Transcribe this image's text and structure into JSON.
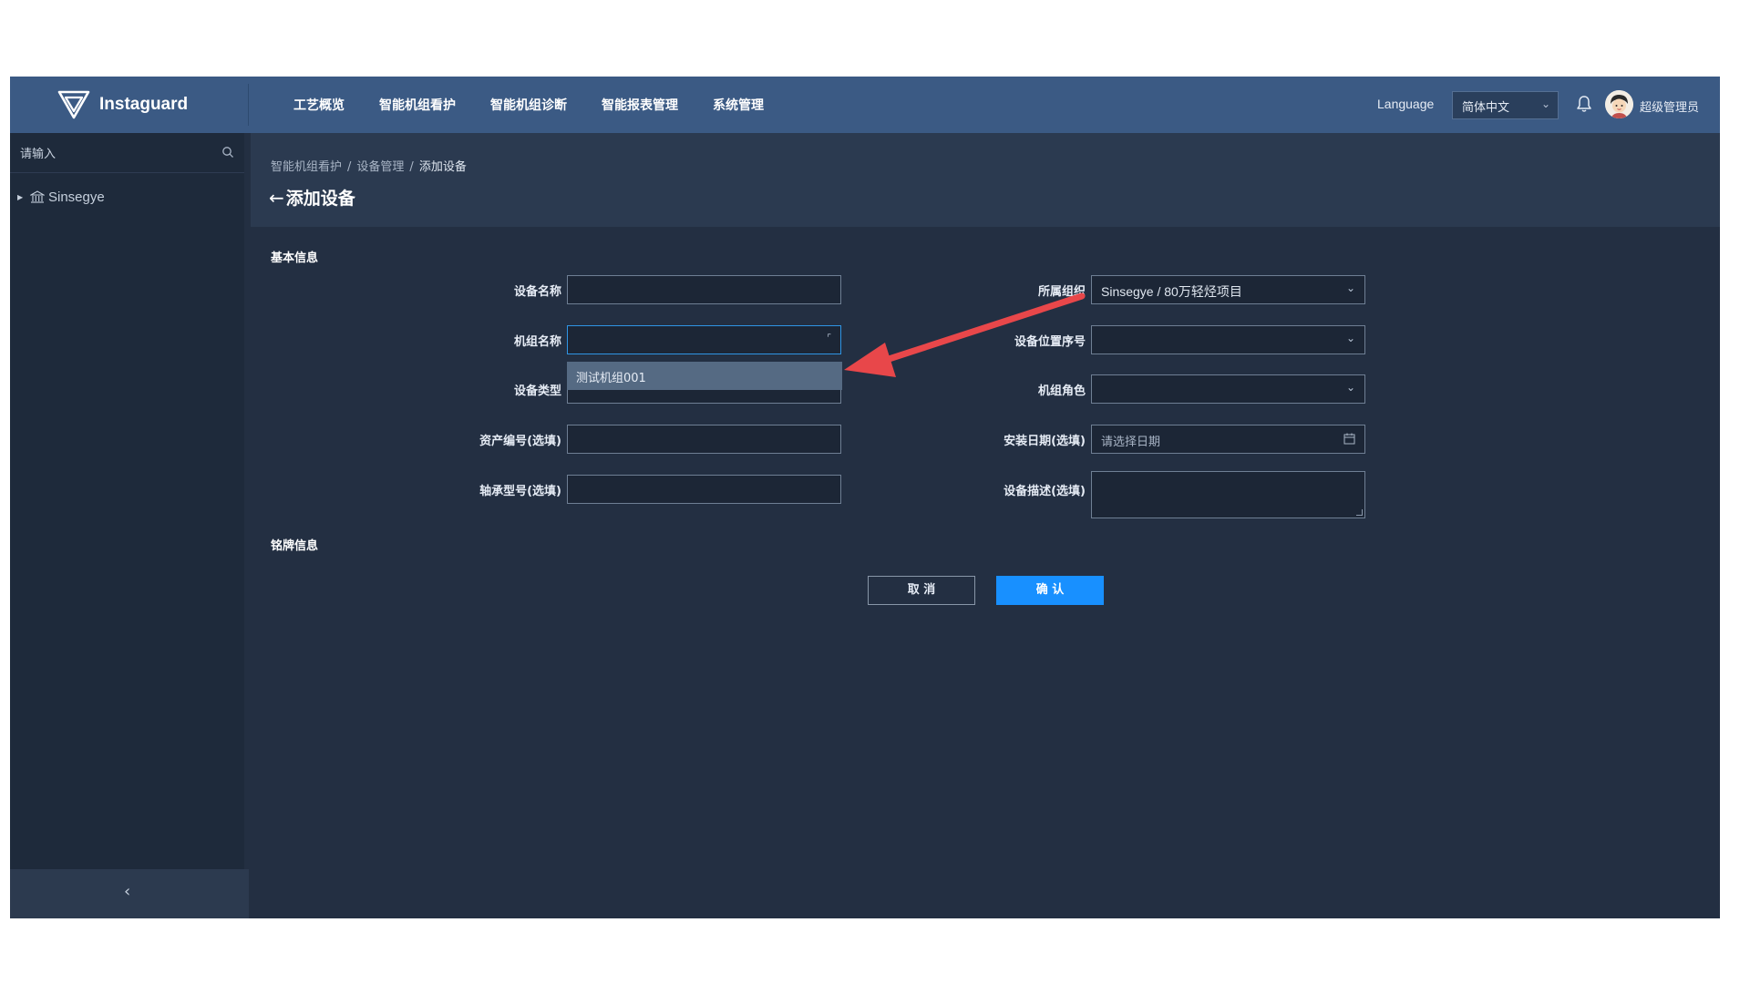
{
  "app": {
    "brand": "Instaguard",
    "nav": [
      "工艺概览",
      "智能机组看护",
      "智能机组诊断",
      "智能报表管理",
      "系统管理"
    ],
    "language_label": "Language",
    "language_value": "简体中文",
    "user_name": "超级管理员"
  },
  "sidebar": {
    "search_placeholder": "请输入",
    "tree_root": "Sinsegye"
  },
  "breadcrumb": [
    "智能机组看护",
    "设备管理",
    "添加设备"
  ],
  "page_title": "添加设备",
  "sections": {
    "basic": "基本信息",
    "nameplate": "铭牌信息"
  },
  "form": {
    "device_name_label": "设备名称",
    "unit_name_label": "机组名称",
    "device_type_label": "设备类型",
    "asset_no_label": "资产编号(选填)",
    "bearing_model_label": "轴承型号(选填)",
    "org_label": "所属组织",
    "org_value": "Sinsegye / 80万轻烃项目",
    "position_no_label": "设备位置序号",
    "unit_role_label": "机组角色",
    "install_date_label": "安装日期(选填)",
    "install_date_placeholder": "请选择日期",
    "description_label": "设备描述(选填)",
    "dropdown_option": "测试机组001"
  },
  "buttons": {
    "cancel": "取 消",
    "confirm": "确 认"
  },
  "colors": {
    "topbar": "#3b5a84",
    "background": "#232f42",
    "primary": "#1890ff",
    "annotation_arrow": "#e8474a"
  }
}
